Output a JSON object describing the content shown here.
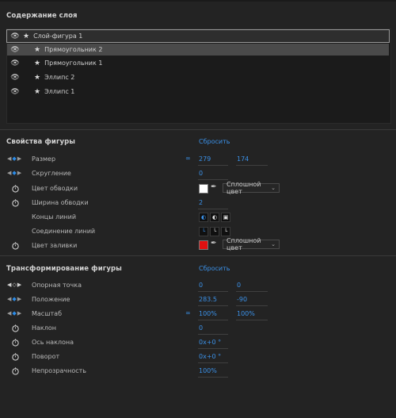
{
  "layers_panel": {
    "title": "Содержание слоя",
    "items": [
      {
        "label": "Слой-фигура 1"
      },
      {
        "label": "Прямоугольник 2"
      },
      {
        "label": "Прямоугольник 1"
      },
      {
        "label": "Эллипс 2"
      },
      {
        "label": "Эллипс 1"
      }
    ]
  },
  "shape_props": {
    "title": "Свойства фигуры",
    "reset_label": "Сбросить",
    "size_label": "Размер",
    "size_w": "279",
    "size_h": "174",
    "rounding_label": "Скругление",
    "rounding_value": "0",
    "stroke_color_label": "Цвет обводки",
    "stroke_color": "#ffffff",
    "stroke_type": "Сплошной цвет",
    "stroke_width_label": "Ширина обводки",
    "stroke_width_value": "2",
    "line_caps_label": "Концы линий",
    "line_joins_label": "Соединение линий",
    "fill_color_label": "Цвет заливки",
    "fill_color": "#e01010",
    "fill_type": "Сплошной цвет"
  },
  "transform": {
    "title": "Трансформирование фигуры",
    "reset_label": "Сбросить",
    "anchor_label": "Опорная точка",
    "anchor_x": "0",
    "anchor_y": "0",
    "position_label": "Положение",
    "position_x": "283.5",
    "position_y": "-90",
    "scale_label": "Масштаб",
    "scale_x": "100%",
    "scale_y": "100%",
    "skew_label": "Наклон",
    "skew_value": "0",
    "skew_axis_label": "Ось наклона",
    "skew_axis_value": "0x+0 °",
    "rotation_label": "Поворот",
    "rotation_value": "0x+0 °",
    "opacity_label": "Непрозрачность",
    "opacity_value": "100%"
  },
  "colors": {
    "accent": "#3b91e8",
    "background": "#232323"
  }
}
